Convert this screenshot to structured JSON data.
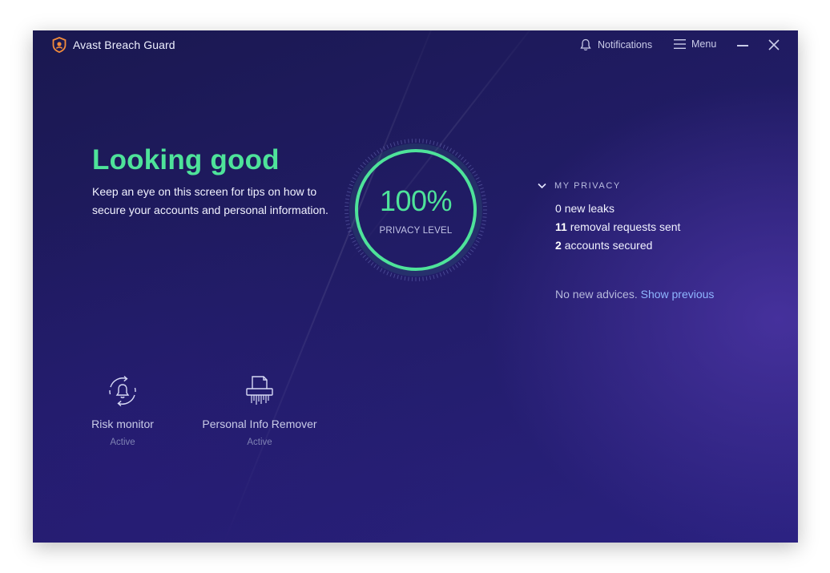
{
  "app": {
    "title": "Avast Breach Guard",
    "logo_icon": "avast-shield-icon"
  },
  "titlebar": {
    "notifications_label": "Notifications",
    "menu_label": "Menu"
  },
  "status": {
    "headline": "Looking good",
    "description": "Keep an eye on this screen for tips on how to secure your accounts and personal information."
  },
  "privacy_gauge": {
    "value": "100%",
    "label": "PRIVACY LEVEL",
    "level_fraction": 1.0
  },
  "my_privacy": {
    "section_label": "MY PRIVACY",
    "stats": [
      {
        "count": "0",
        "text": "new leaks",
        "bold": false
      },
      {
        "count": "11",
        "text": "removal requests sent",
        "bold": true
      },
      {
        "count": "2",
        "text": "accounts secured",
        "bold": true
      }
    ],
    "advice_text": "No new advices.",
    "advice_link": "Show previous"
  },
  "features": [
    {
      "name": "Risk monitor",
      "state": "Active",
      "icon": "bell-cycle-icon"
    },
    {
      "name": "Personal Info Remover",
      "state": "Active",
      "icon": "shredder-icon"
    }
  ],
  "colors": {
    "accent": "#4ee39a",
    "background": "#211c66",
    "link": "#8fb6ff",
    "logo": "#f28b3c"
  }
}
